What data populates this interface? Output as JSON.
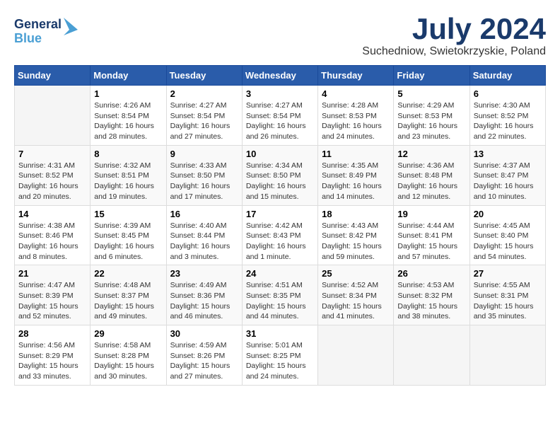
{
  "header": {
    "logo_line1": "General",
    "logo_line2": "Blue",
    "month_year": "July 2024",
    "location": "Suchedniow, Swietokrzyskie, Poland"
  },
  "days_of_week": [
    "Sunday",
    "Monday",
    "Tuesday",
    "Wednesday",
    "Thursday",
    "Friday",
    "Saturday"
  ],
  "weeks": [
    [
      {
        "day": "",
        "info": ""
      },
      {
        "day": "1",
        "info": "Sunrise: 4:26 AM\nSunset: 8:54 PM\nDaylight: 16 hours\nand 28 minutes."
      },
      {
        "day": "2",
        "info": "Sunrise: 4:27 AM\nSunset: 8:54 PM\nDaylight: 16 hours\nand 27 minutes."
      },
      {
        "day": "3",
        "info": "Sunrise: 4:27 AM\nSunset: 8:54 PM\nDaylight: 16 hours\nand 26 minutes."
      },
      {
        "day": "4",
        "info": "Sunrise: 4:28 AM\nSunset: 8:53 PM\nDaylight: 16 hours\nand 24 minutes."
      },
      {
        "day": "5",
        "info": "Sunrise: 4:29 AM\nSunset: 8:53 PM\nDaylight: 16 hours\nand 23 minutes."
      },
      {
        "day": "6",
        "info": "Sunrise: 4:30 AM\nSunset: 8:52 PM\nDaylight: 16 hours\nand 22 minutes."
      }
    ],
    [
      {
        "day": "7",
        "info": "Sunrise: 4:31 AM\nSunset: 8:52 PM\nDaylight: 16 hours\nand 20 minutes."
      },
      {
        "day": "8",
        "info": "Sunrise: 4:32 AM\nSunset: 8:51 PM\nDaylight: 16 hours\nand 19 minutes."
      },
      {
        "day": "9",
        "info": "Sunrise: 4:33 AM\nSunset: 8:50 PM\nDaylight: 16 hours\nand 17 minutes."
      },
      {
        "day": "10",
        "info": "Sunrise: 4:34 AM\nSunset: 8:50 PM\nDaylight: 16 hours\nand 15 minutes."
      },
      {
        "day": "11",
        "info": "Sunrise: 4:35 AM\nSunset: 8:49 PM\nDaylight: 16 hours\nand 14 minutes."
      },
      {
        "day": "12",
        "info": "Sunrise: 4:36 AM\nSunset: 8:48 PM\nDaylight: 16 hours\nand 12 minutes."
      },
      {
        "day": "13",
        "info": "Sunrise: 4:37 AM\nSunset: 8:47 PM\nDaylight: 16 hours\nand 10 minutes."
      }
    ],
    [
      {
        "day": "14",
        "info": "Sunrise: 4:38 AM\nSunset: 8:46 PM\nDaylight: 16 hours\nand 8 minutes."
      },
      {
        "day": "15",
        "info": "Sunrise: 4:39 AM\nSunset: 8:45 PM\nDaylight: 16 hours\nand 6 minutes."
      },
      {
        "day": "16",
        "info": "Sunrise: 4:40 AM\nSunset: 8:44 PM\nDaylight: 16 hours\nand 3 minutes."
      },
      {
        "day": "17",
        "info": "Sunrise: 4:42 AM\nSunset: 8:43 PM\nDaylight: 16 hours\nand 1 minute."
      },
      {
        "day": "18",
        "info": "Sunrise: 4:43 AM\nSunset: 8:42 PM\nDaylight: 15 hours\nand 59 minutes."
      },
      {
        "day": "19",
        "info": "Sunrise: 4:44 AM\nSunset: 8:41 PM\nDaylight: 15 hours\nand 57 minutes."
      },
      {
        "day": "20",
        "info": "Sunrise: 4:45 AM\nSunset: 8:40 PM\nDaylight: 15 hours\nand 54 minutes."
      }
    ],
    [
      {
        "day": "21",
        "info": "Sunrise: 4:47 AM\nSunset: 8:39 PM\nDaylight: 15 hours\nand 52 minutes."
      },
      {
        "day": "22",
        "info": "Sunrise: 4:48 AM\nSunset: 8:37 PM\nDaylight: 15 hours\nand 49 minutes."
      },
      {
        "day": "23",
        "info": "Sunrise: 4:49 AM\nSunset: 8:36 PM\nDaylight: 15 hours\nand 46 minutes."
      },
      {
        "day": "24",
        "info": "Sunrise: 4:51 AM\nSunset: 8:35 PM\nDaylight: 15 hours\nand 44 minutes."
      },
      {
        "day": "25",
        "info": "Sunrise: 4:52 AM\nSunset: 8:34 PM\nDaylight: 15 hours\nand 41 minutes."
      },
      {
        "day": "26",
        "info": "Sunrise: 4:53 AM\nSunset: 8:32 PM\nDaylight: 15 hours\nand 38 minutes."
      },
      {
        "day": "27",
        "info": "Sunrise: 4:55 AM\nSunset: 8:31 PM\nDaylight: 15 hours\nand 35 minutes."
      }
    ],
    [
      {
        "day": "28",
        "info": "Sunrise: 4:56 AM\nSunset: 8:29 PM\nDaylight: 15 hours\nand 33 minutes."
      },
      {
        "day": "29",
        "info": "Sunrise: 4:58 AM\nSunset: 8:28 PM\nDaylight: 15 hours\nand 30 minutes."
      },
      {
        "day": "30",
        "info": "Sunrise: 4:59 AM\nSunset: 8:26 PM\nDaylight: 15 hours\nand 27 minutes."
      },
      {
        "day": "31",
        "info": "Sunrise: 5:01 AM\nSunset: 8:25 PM\nDaylight: 15 hours\nand 24 minutes."
      },
      {
        "day": "",
        "info": ""
      },
      {
        "day": "",
        "info": ""
      },
      {
        "day": "",
        "info": ""
      }
    ]
  ]
}
